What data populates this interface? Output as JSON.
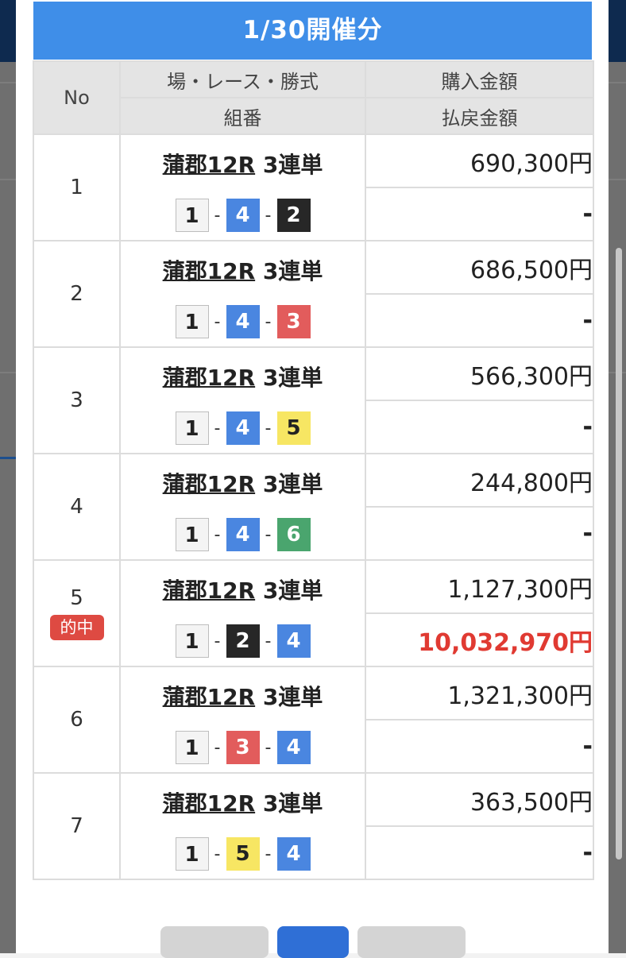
{
  "title": "1/30開催分",
  "header": {
    "no": "No",
    "race_info": "場・レース・勝式",
    "combination": "組番",
    "purchase": "購入金額",
    "payout": "払戻金額"
  },
  "boat_colors": {
    "1": "#f4f4f4",
    "2": "#272727",
    "3": "#e25c5c",
    "4": "#4a86e0",
    "5": "#f7e663",
    "6": "#4aa56e"
  },
  "rows": [
    {
      "no": "1",
      "venue": "蒲郡12R",
      "bet_type": "3連単",
      "combo": [
        "1",
        "4",
        "2"
      ],
      "purchase": "690,300円",
      "payout": "-",
      "hit": false
    },
    {
      "no": "2",
      "venue": "蒲郡12R",
      "bet_type": "3連単",
      "combo": [
        "1",
        "4",
        "3"
      ],
      "purchase": "686,500円",
      "payout": "-",
      "hit": false
    },
    {
      "no": "3",
      "venue": "蒲郡12R",
      "bet_type": "3連単",
      "combo": [
        "1",
        "4",
        "5"
      ],
      "purchase": "566,300円",
      "payout": "-",
      "hit": false
    },
    {
      "no": "4",
      "venue": "蒲郡12R",
      "bet_type": "3連単",
      "combo": [
        "1",
        "4",
        "6"
      ],
      "purchase": "244,800円",
      "payout": "-",
      "hit": false
    },
    {
      "no": "5",
      "venue": "蒲郡12R",
      "bet_type": "3連単",
      "combo": [
        "1",
        "2",
        "4"
      ],
      "purchase": "1,127,300円",
      "payout": "10,032,970円",
      "hit": true,
      "hit_label": "的中"
    },
    {
      "no": "6",
      "venue": "蒲郡12R",
      "bet_type": "3連単",
      "combo": [
        "1",
        "3",
        "4"
      ],
      "purchase": "1,321,300円",
      "payout": "-",
      "hit": false
    },
    {
      "no": "7",
      "venue": "蒲郡12R",
      "bet_type": "3連単",
      "combo": [
        "1",
        "5",
        "4"
      ],
      "purchase": "363,500円",
      "payout": "-",
      "hit": false
    }
  ]
}
